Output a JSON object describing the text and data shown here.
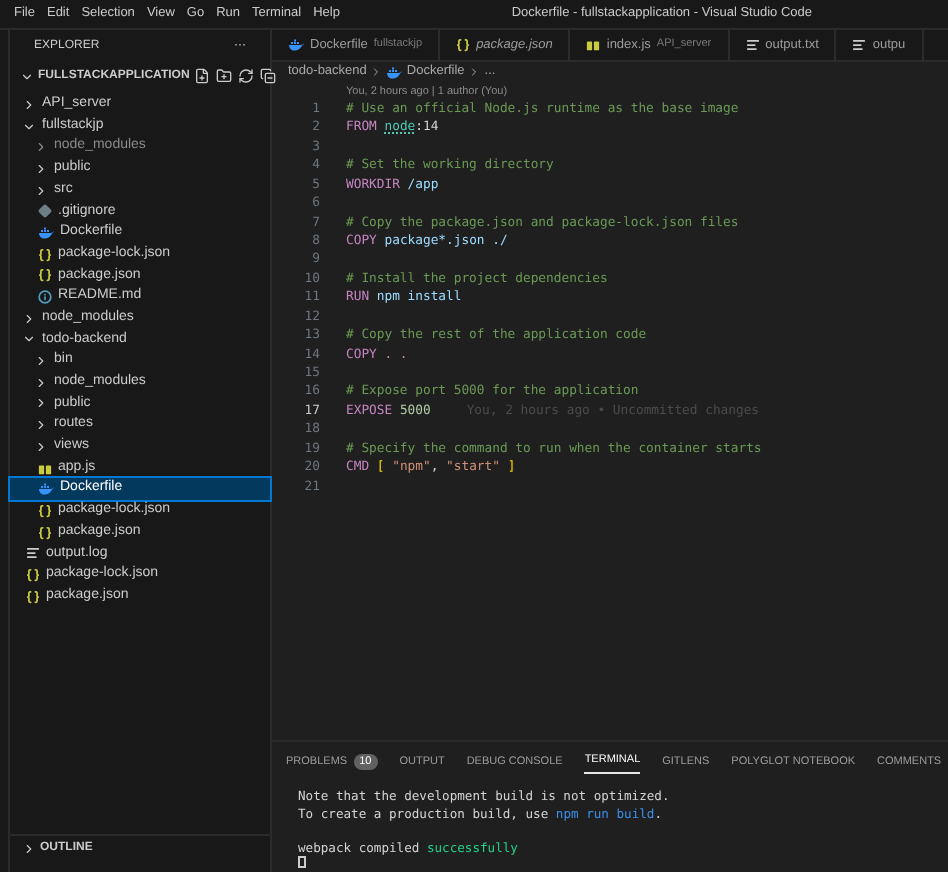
{
  "menu": [
    "File",
    "Edit",
    "Selection",
    "View",
    "Go",
    "Run",
    "Terminal",
    "Help"
  ],
  "window": {
    "title": "Dockerfile - fullstackapplication - Visual Studio Code"
  },
  "sidebar": {
    "title": "EXPLORER",
    "more": "···",
    "workspace": "FULLSTACKAPPLICATION",
    "items": [
      {
        "label": "API_server",
        "kind": "folder",
        "expanded": false,
        "selected": false,
        "ignored": false
      },
      {
        "label": "fullstackjp",
        "kind": "folder",
        "expanded": true,
        "selected": false,
        "ignored": false,
        "children": [
          {
            "label": "node_modules",
            "kind": "folder",
            "expanded": false,
            "selected": false,
            "ignored": true
          },
          {
            "label": "public",
            "kind": "folder",
            "expanded": false,
            "selected": false,
            "ignored": false
          },
          {
            "label": "src",
            "kind": "folder",
            "expanded": false,
            "selected": false,
            "ignored": false
          },
          {
            "label": ".gitignore",
            "kind": "git",
            "selected": false,
            "ignored": false
          },
          {
            "label": "Dockerfile",
            "kind": "docker",
            "selected": false,
            "ignored": false
          },
          {
            "label": "package-lock.json",
            "kind": "json",
            "selected": false,
            "ignored": false
          },
          {
            "label": "package.json",
            "kind": "json",
            "selected": false,
            "ignored": false
          },
          {
            "label": "README.md",
            "kind": "info",
            "selected": false,
            "ignored": false
          }
        ]
      },
      {
        "label": "node_modules",
        "kind": "folder",
        "expanded": false,
        "selected": false,
        "ignored": false
      },
      {
        "label": "todo-backend",
        "kind": "folder",
        "expanded": true,
        "selected": false,
        "ignored": false,
        "children": [
          {
            "label": "bin",
            "kind": "folder",
            "expanded": false,
            "selected": false,
            "ignored": false
          },
          {
            "label": "node_modules",
            "kind": "folder",
            "expanded": false,
            "selected": false,
            "ignored": false
          },
          {
            "label": "public",
            "kind": "folder",
            "expanded": false,
            "selected": false,
            "ignored": false
          },
          {
            "label": "routes",
            "kind": "folder",
            "expanded": false,
            "selected": false,
            "ignored": false
          },
          {
            "label": "views",
            "kind": "folder",
            "expanded": false,
            "selected": false,
            "ignored": false
          },
          {
            "label": "app.js",
            "kind": "js",
            "selected": false,
            "ignored": false
          },
          {
            "label": "Dockerfile",
            "kind": "docker",
            "selected": true,
            "ignored": false
          },
          {
            "label": "package-lock.json",
            "kind": "json",
            "selected": false,
            "ignored": false
          },
          {
            "label": "package.json",
            "kind": "json",
            "selected": false,
            "ignored": false
          }
        ]
      },
      {
        "label": "output.log",
        "kind": "text",
        "selected": false,
        "ignored": false
      },
      {
        "label": "package-lock.json",
        "kind": "json",
        "selected": false,
        "ignored": false
      },
      {
        "label": "package.json",
        "kind": "json",
        "selected": false,
        "ignored": false
      }
    ],
    "sections": [
      "OUTLINE"
    ]
  },
  "tabs": [
    {
      "label": "Dockerfile",
      "detail": "fullstackjp",
      "kind": "docker",
      "italic": false,
      "selected": false
    },
    {
      "label": "package.json",
      "kind": "json",
      "italic": true,
      "selected": false
    },
    {
      "label": "index.js",
      "detail": "API_server",
      "kind": "js",
      "italic": false,
      "selected": false
    },
    {
      "label": "output.txt",
      "kind": "text",
      "italic": false,
      "selected": false
    },
    {
      "label": "outpu",
      "kind": "text",
      "italic": false,
      "selected": false
    }
  ],
  "breadcrumb": [
    {
      "label": "todo-backend",
      "kind": "folder"
    },
    {
      "label": "Dockerfile",
      "kind": "docker"
    },
    {
      "label": "...",
      "kind": "more"
    }
  ],
  "codelens": "You, 2 hours ago | 1 author (You)",
  "code": [
    {
      "number": "1",
      "current": false,
      "segments": [
        {
          "text": "# Use an official Node.js runtime as the base image",
          "kind": "comment"
        }
      ]
    },
    {
      "number": "2",
      "current": false,
      "segments": [
        {
          "text": "FROM ",
          "kind": "keyword"
        },
        {
          "text": "node",
          "kind": "type"
        },
        {
          "text": ":14",
          "kind": "plain"
        }
      ]
    },
    {
      "number": "3",
      "current": false
    },
    {
      "number": "4",
      "current": false,
      "segments": [
        {
          "text": "# Set the working directory",
          "kind": "comment"
        }
      ]
    },
    {
      "number": "5",
      "current": false,
      "segments": [
        {
          "text": "WORKDIR ",
          "kind": "keyword"
        },
        {
          "text": "/app",
          "kind": "variable"
        }
      ]
    },
    {
      "number": "6",
      "current": false
    },
    {
      "number": "7",
      "current": false,
      "segments": [
        {
          "text": "# Copy the package.json and package-lock.json files",
          "kind": "comment"
        }
      ]
    },
    {
      "number": "8",
      "current": false,
      "segments": [
        {
          "text": "COPY ",
          "kind": "keyword"
        },
        {
          "text": "package*.json ./",
          "kind": "variable"
        }
      ]
    },
    {
      "number": "9",
      "current": false
    },
    {
      "number": "10",
      "current": false,
      "segments": [
        {
          "text": "# Install the project dependencies",
          "kind": "comment"
        }
      ]
    },
    {
      "number": "11",
      "current": false,
      "segments": [
        {
          "text": "RUN ",
          "kind": "keyword"
        },
        {
          "text": "npm install",
          "kind": "variable"
        }
      ]
    },
    {
      "number": "12",
      "current": false
    },
    {
      "number": "13",
      "current": false,
      "segments": [
        {
          "text": "# Copy the rest of the application code",
          "kind": "comment"
        }
      ]
    },
    {
      "number": "14",
      "current": false,
      "segments": [
        {
          "text": "COPY . .",
          "kind": "keyword"
        }
      ]
    },
    {
      "number": "15",
      "current": false
    },
    {
      "number": "16",
      "current": false,
      "segments": [
        {
          "text": "# Expose port 5000 for the application",
          "kind": "comment"
        }
      ]
    },
    {
      "number": "17",
      "current": true,
      "blame": "You, 2 hours ago • Uncommitted changes",
      "segments": [
        {
          "text": "EXPOSE ",
          "kind": "keyword"
        },
        {
          "text": "5000",
          "kind": "number"
        }
      ]
    },
    {
      "number": "18",
      "current": false
    },
    {
      "number": "19",
      "current": false,
      "segments": [
        {
          "text": "# Specify the command to run when the container starts",
          "kind": "comment"
        }
      ]
    },
    {
      "number": "20",
      "current": false,
      "segments": [
        {
          "text": "CMD ",
          "kind": "keyword"
        },
        {
          "text": "[ ",
          "kind": "bracket"
        },
        {
          "text": "\"npm\"",
          "kind": "string"
        },
        {
          "text": ", ",
          "kind": "plain"
        },
        {
          "text": "\"start\"",
          "kind": "string"
        },
        {
          "text": " ]",
          "kind": "bracket"
        }
      ]
    },
    {
      "number": "21",
      "current": false
    }
  ],
  "panel": {
    "tabs": [
      {
        "label": "PROBLEMS",
        "badge": "10",
        "selected": false
      },
      {
        "label": "OUTPUT",
        "selected": false
      },
      {
        "label": "DEBUG CONSOLE",
        "selected": false
      },
      {
        "label": "TERMINAL",
        "selected": true
      },
      {
        "label": "GITLENS",
        "selected": false
      },
      {
        "label": "POLYGLOT NOTEBOOK",
        "selected": false
      },
      {
        "label": "COMMENTS",
        "selected": false
      }
    ],
    "terminal": [
      {
        "lines": [
          {
            "segments": [
              {
                "text": "Note that the development build is not optimized.",
                "kind": "plain"
              }
            ]
          },
          {
            "segments": [
              {
                "text": "To create a production build, use ",
                "kind": "plain"
              },
              {
                "text": "npm run build",
                "kind": "command"
              },
              {
                "text": ".",
                "kind": "plain"
              }
            ]
          }
        ]
      },
      {
        "lines": [
          {
            "segments": [
              {
                "text": "webpack compiled ",
                "kind": "plain"
              },
              {
                "text": "successfully",
                "kind": "success"
              }
            ]
          }
        ]
      }
    ]
  }
}
